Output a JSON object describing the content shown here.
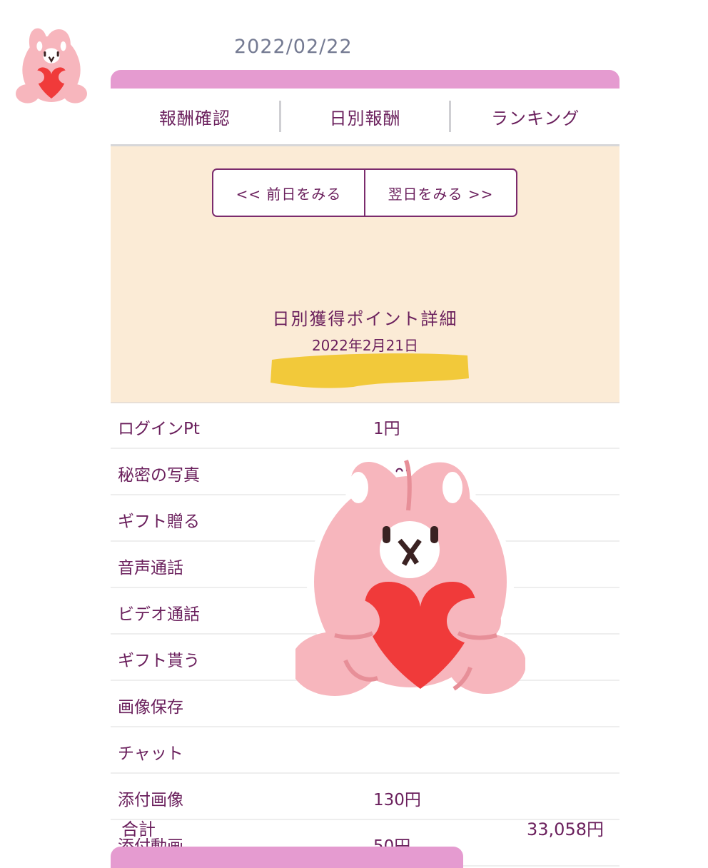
{
  "top_date": "2022/02/22",
  "tabs": [
    {
      "label": "報酬確認"
    },
    {
      "label": "日別報酬"
    },
    {
      "label": "ランキング"
    }
  ],
  "nav": {
    "prev_label": "<< 前日をみる",
    "next_label": "翌日をみる >>"
  },
  "detail": {
    "title": "日別獲得ポイント詳細",
    "date": "2022年2月21日"
  },
  "rows": [
    {
      "label": "ログインPt",
      "value": "1円"
    },
    {
      "label": "秘密の写真",
      "value": "140円"
    },
    {
      "label": "ギフト贈る",
      "value": ""
    },
    {
      "label": "音声通話",
      "value": ""
    },
    {
      "label": "ビデオ通話",
      "value": ""
    },
    {
      "label": "ギフト貰う",
      "value": ""
    },
    {
      "label": "画像保存",
      "value": ""
    },
    {
      "label": "チャット",
      "value": ""
    },
    {
      "label": "添付画像",
      "value": "130円"
    },
    {
      "label": "添付動画",
      "value": "50円"
    }
  ],
  "total": {
    "label": "合計",
    "value": "33,058円"
  },
  "colors": {
    "accent_pink": "#e59bd0",
    "text_purple": "#6a1f5c",
    "header_bg": "#fbebd6",
    "redaction_yellow": "#f2c93a"
  },
  "stickers": [
    {
      "name": "bunny-heart-sticker-small"
    },
    {
      "name": "bunny-heart-sticker-large"
    }
  ]
}
